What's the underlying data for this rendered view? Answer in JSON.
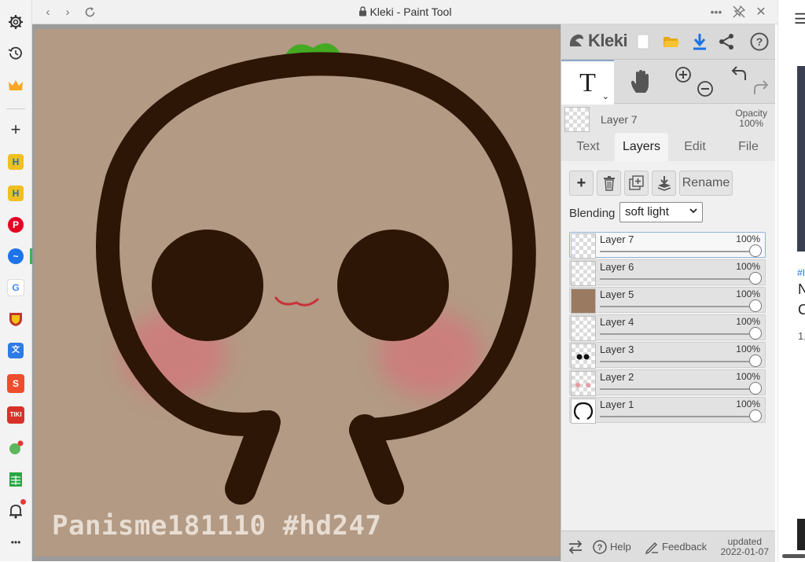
{
  "window": {
    "title": "Kleki - Paint Tool"
  },
  "sidebar": {
    "items": [
      {
        "name": "settings-icon"
      },
      {
        "name": "history-icon"
      },
      {
        "name": "crown-icon"
      },
      {
        "name": "add-icon"
      },
      {
        "name": "app-h1-icon",
        "label": "H"
      },
      {
        "name": "app-h2-icon",
        "label": "H"
      },
      {
        "name": "pinterest-icon",
        "label": "P"
      },
      {
        "name": "messenger-icon"
      },
      {
        "name": "google-icon",
        "label": "G"
      },
      {
        "name": "shield-app-icon"
      },
      {
        "name": "translate-icon"
      },
      {
        "name": "shopee-icon",
        "label": "S"
      },
      {
        "name": "tiki-icon",
        "label": "TIKI"
      },
      {
        "name": "chat-app-icon"
      },
      {
        "name": "sheets-icon"
      },
      {
        "name": "notifications-icon"
      },
      {
        "name": "more-icon",
        "label": "•••"
      }
    ]
  },
  "canvas": {
    "watermark": "Panisme181110 #hd247",
    "background": "#b29a84",
    "outline_color": "#2e1606",
    "blush_color": "#d4767a",
    "sprout_color": "#44aa22"
  },
  "panel": {
    "logo": "Kleki",
    "active_layer": "Layer 7",
    "opacity_label": "Opacity",
    "opacity_value": "100%",
    "tabs": [
      "Text",
      "Layers",
      "Edit",
      "File"
    ],
    "active_tab": "Layers",
    "rename_label": "Rename",
    "blending_label": "Blending",
    "blending_value": "soft light",
    "layers": [
      {
        "name": "Layer 7",
        "opacity": "100%",
        "selected": true
      },
      {
        "name": "Layer 6",
        "opacity": "100%"
      },
      {
        "name": "Layer 5",
        "opacity": "100%"
      },
      {
        "name": "Layer 4",
        "opacity": "100%"
      },
      {
        "name": "Layer 3",
        "opacity": "100%"
      },
      {
        "name": "Layer 2",
        "opacity": "100%"
      },
      {
        "name": "Layer 1",
        "opacity": "100%"
      }
    ],
    "help_label": "Help",
    "feedback_label": "Feedback",
    "updated_label": "updated",
    "updated_date": "2022-01-07"
  },
  "right_sliver": {
    "hash": "#I",
    "n": "N",
    "c": "C",
    "num": "1,"
  }
}
